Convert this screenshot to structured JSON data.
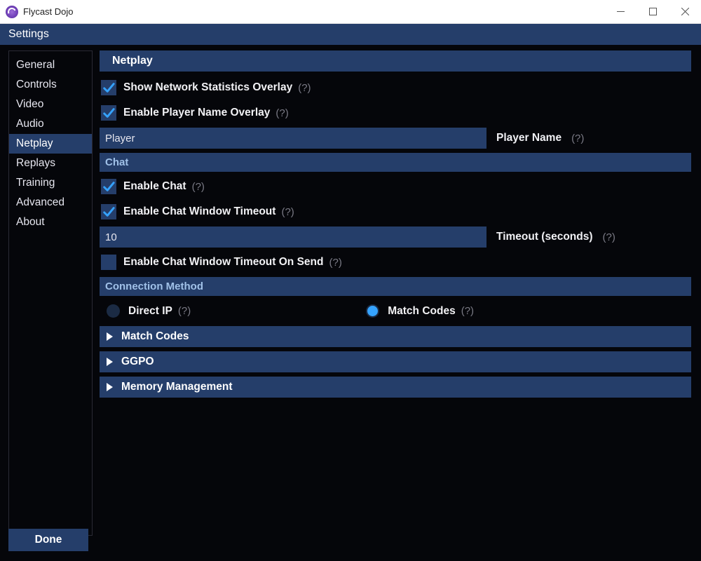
{
  "window": {
    "title": "Flycast Dojo"
  },
  "subheader": "Settings",
  "sidebar": {
    "items": [
      {
        "label": "General"
      },
      {
        "label": "Controls"
      },
      {
        "label": "Video"
      },
      {
        "label": "Audio"
      },
      {
        "label": "Netplay"
      },
      {
        "label": "Replays"
      },
      {
        "label": "Training"
      },
      {
        "label": "Advanced"
      },
      {
        "label": "About"
      }
    ],
    "active_index": 4
  },
  "main": {
    "title": "Netplay",
    "help_hint": "(?)",
    "checkboxes": {
      "show_net_stats": {
        "label": "Show Network Statistics Overlay",
        "checked": true
      },
      "enable_name_overlay": {
        "label": "Enable Player Name Overlay",
        "checked": true
      },
      "enable_chat": {
        "label": "Enable Chat",
        "checked": true
      },
      "enable_chat_timeout": {
        "label": "Enable Chat Window Timeout",
        "checked": true
      },
      "enable_chat_timeout_on_send": {
        "label": "Enable Chat Window Timeout On Send",
        "checked": false
      }
    },
    "player": {
      "value": "Player",
      "label": "Player Name"
    },
    "chat_header": "Chat",
    "timeout": {
      "value": "10",
      "label": "Timeout (seconds)"
    },
    "connection_header": "Connection Method",
    "connection": {
      "direct_ip": "Direct IP",
      "match_codes": "Match Codes",
      "selected": "match_codes"
    },
    "collapsers": [
      {
        "label": "Match Codes"
      },
      {
        "label": "GGPO"
      },
      {
        "label": "Memory Management"
      }
    ]
  },
  "footer": {
    "done": "Done"
  }
}
